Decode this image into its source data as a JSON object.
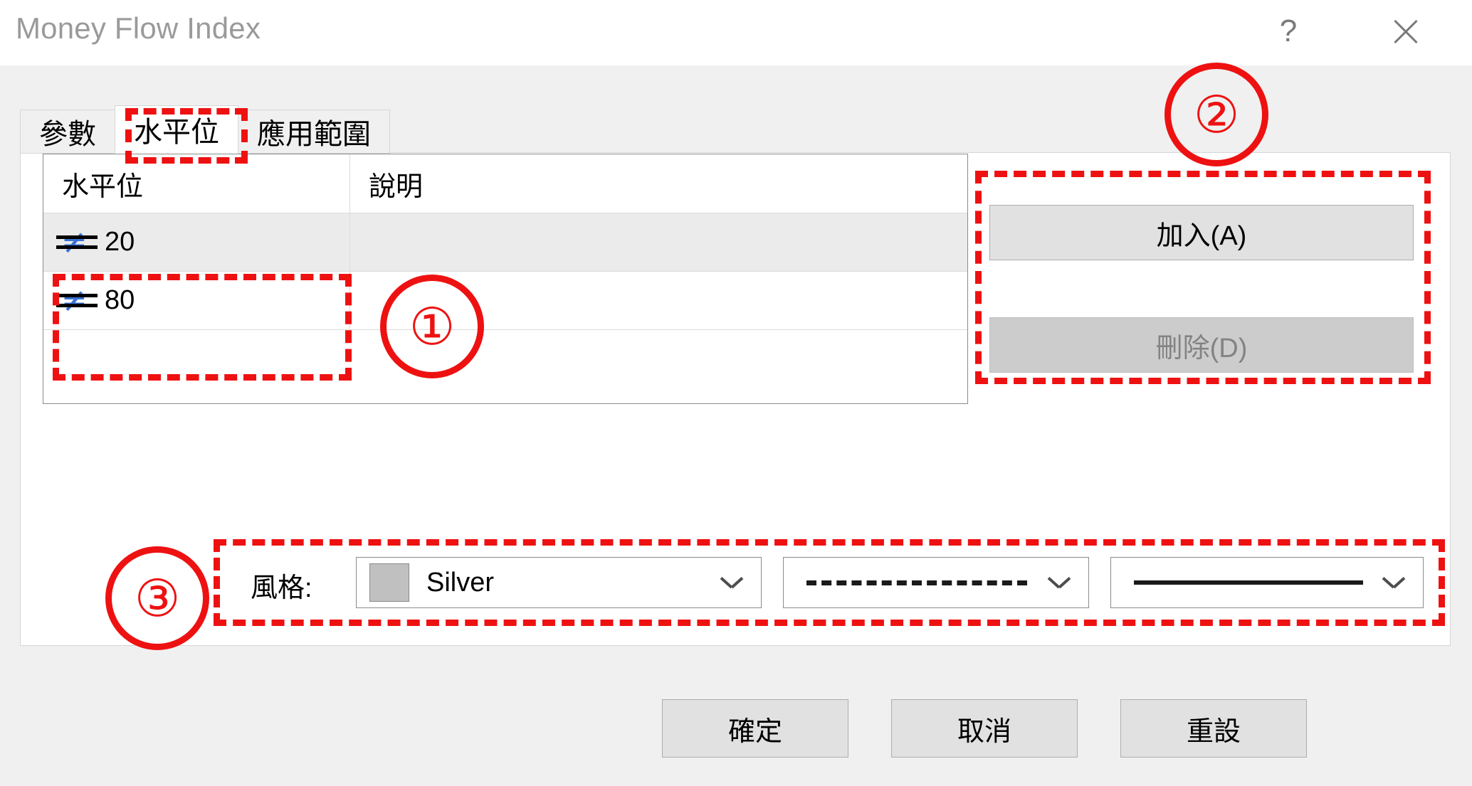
{
  "window": {
    "title": "Money Flow Index",
    "help_label": "?",
    "close_label": "×"
  },
  "tabs": [
    {
      "label": "參數",
      "active": false
    },
    {
      "label": "水平位",
      "active": true
    },
    {
      "label": "應用範圍",
      "active": false
    }
  ],
  "levels_table": {
    "columns": [
      "水平位",
      "說明"
    ],
    "rows": [
      {
        "level": "20",
        "description": "",
        "selected": true,
        "icon": "level-line-icon"
      },
      {
        "level": "80",
        "description": "",
        "selected": false,
        "icon": "level-line-icon"
      }
    ]
  },
  "side_buttons": {
    "add_label": "加入(A)",
    "delete_label": "刪除(D)",
    "add_enabled": true,
    "delete_enabled": false
  },
  "style_row": {
    "label": "風格:",
    "color_name": "Silver",
    "color_hex": "#c0c0c0",
    "line_style": "dashed",
    "line_width": "solid"
  },
  "footer_buttons": {
    "ok_label": "確定",
    "cancel_label": "取消",
    "reset_label": "重設"
  },
  "annotations": {
    "accent_color": "#ee1111",
    "markers": [
      {
        "id": "1",
        "label": "①",
        "target": "levels-table-rows"
      },
      {
        "id": "2",
        "label": "②",
        "target": "add-delete-buttons"
      },
      {
        "id": "3",
        "label": "③",
        "target": "style-row"
      }
    ],
    "marker_1": "①",
    "marker_2": "②",
    "marker_3": "③"
  }
}
